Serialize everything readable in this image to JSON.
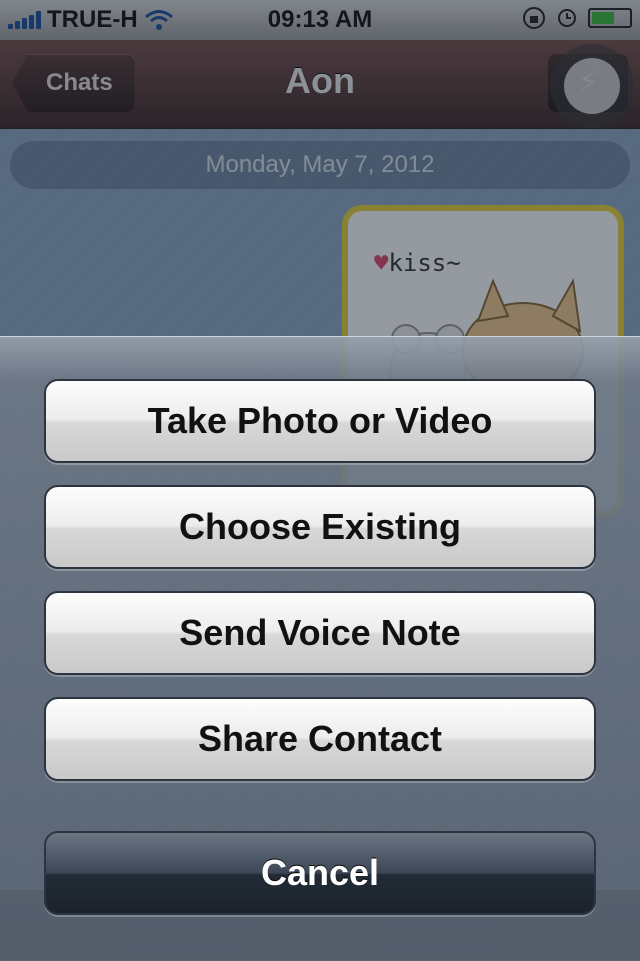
{
  "status_bar": {
    "carrier": "TRUE-H",
    "time": "09:13 AM",
    "battery_level": 0.6
  },
  "nav": {
    "back_label": "Chats",
    "title": "Aon"
  },
  "chat": {
    "date": "Monday, May 7, 2012",
    "sticker_text": "kiss~"
  },
  "action_sheet": {
    "options": [
      "Take Photo or Video",
      "Choose Existing",
      "Send Voice Note",
      "Share Contact"
    ],
    "cancel_label": "Cancel"
  },
  "colors": {
    "nav_bar": "#5a3c39",
    "signal": "#1a4fa0",
    "battery": "#3cba3c",
    "sticker_border": "#e9d23a"
  }
}
